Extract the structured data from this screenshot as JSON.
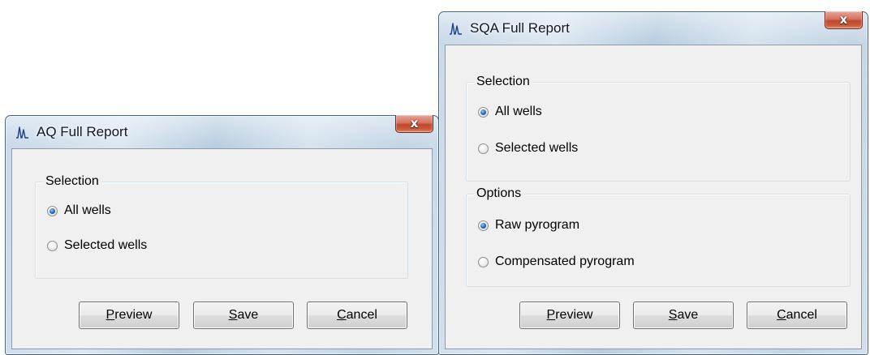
{
  "aq_dialog": {
    "title": "AQ Full Report",
    "close_glyph": "x",
    "selection": {
      "label": "Selection",
      "options": [
        {
          "label": "All wells",
          "checked": true
        },
        {
          "label": "Selected wells",
          "checked": false
        }
      ]
    },
    "buttons": {
      "preview": {
        "mnemonic": "P",
        "rest": "review"
      },
      "save": {
        "mnemonic": "S",
        "rest": "ave"
      },
      "cancel": {
        "mnemonic": "C",
        "rest": "ancel"
      }
    }
  },
  "sqa_dialog": {
    "title": "SQA Full Report",
    "close_glyph": "x",
    "selection": {
      "label": "Selection",
      "options": [
        {
          "label": "All wells",
          "checked": true
        },
        {
          "label": "Selected wells",
          "checked": false
        }
      ]
    },
    "options_group": {
      "label": "Options",
      "options": [
        {
          "label": "Raw pyrogram",
          "checked": true
        },
        {
          "label": "Compensated pyrogram",
          "checked": false
        }
      ]
    },
    "buttons": {
      "preview": {
        "mnemonic": "P",
        "rest": "review"
      },
      "save": {
        "mnemonic": "S",
        "rest": "ave"
      },
      "cancel": {
        "mnemonic": "C",
        "rest": "ancel"
      }
    }
  },
  "icons": {
    "app_icon": "pyrogram-peaks-icon",
    "close_icon": "close-icon"
  },
  "colors": {
    "radio_checked": "#1e63b5",
    "close_button": "#c8583b",
    "dialog_face": "#f0f0f0"
  }
}
